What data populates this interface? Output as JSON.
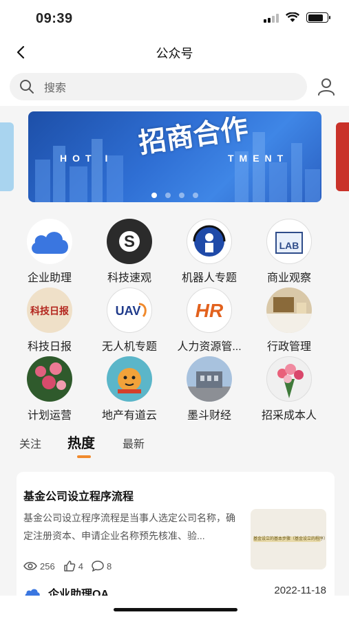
{
  "status": {
    "time": "09:39",
    "battery_level": 0.8
  },
  "nav": {
    "title": "公众号",
    "back_icon": "chevron-left-icon"
  },
  "search": {
    "placeholder": "搜索",
    "icon": "search-icon",
    "profile_icon": "user-icon"
  },
  "banner": {
    "text_left": "HOT I",
    "text_right": "TMENT",
    "calligraphy": "招商合作",
    "slides": 4,
    "active_slide": 0
  },
  "accounts": [
    {
      "label": "企业助理",
      "icon": "cloud-icon"
    },
    {
      "label": "科技速观",
      "icon": "s-logo-icon"
    },
    {
      "label": "机器人专题",
      "icon": "robot-icon"
    },
    {
      "label": "商业观察",
      "icon": "lab-icon"
    },
    {
      "label": "科技日报",
      "icon": "newspaper-icon"
    },
    {
      "label": "无人机专题",
      "icon": "uav-icon"
    },
    {
      "label": "人力资源管...",
      "icon": "hr-icon"
    },
    {
      "label": "行政管理",
      "icon": "desk-icon"
    },
    {
      "label": "计划运营",
      "icon": "flowers-icon"
    },
    {
      "label": "地产有道云",
      "icon": "tiger-icon"
    },
    {
      "label": "墨斗财经",
      "icon": "building-icon"
    },
    {
      "label": "招采成本人",
      "icon": "bouquet-icon"
    }
  ],
  "accounts_logo_text": {
    "s": "S",
    "uav": "UAV",
    "hr": "HR",
    "lab": "LAB",
    "news": "科技日报"
  },
  "tabs": [
    {
      "label": "关注",
      "active": false
    },
    {
      "label": "热度",
      "active": true
    },
    {
      "label": "最新",
      "active": false
    }
  ],
  "article": {
    "title": "基金公司设立程序流程",
    "summary": "基金公司设立程序流程是当事人选定公司名称，确定注册资本、申请企业名称预先核准、验...",
    "thumb_text": "基金设立的基本步骤（基金设立的程序）",
    "views": "256",
    "likes": "4",
    "comments": "8",
    "author": "企业助理OA",
    "date": "2022-11-18"
  },
  "colors": {
    "accent": "#f08a2d",
    "banner": "#2f6fd4",
    "cloud": "#3a76e0"
  }
}
